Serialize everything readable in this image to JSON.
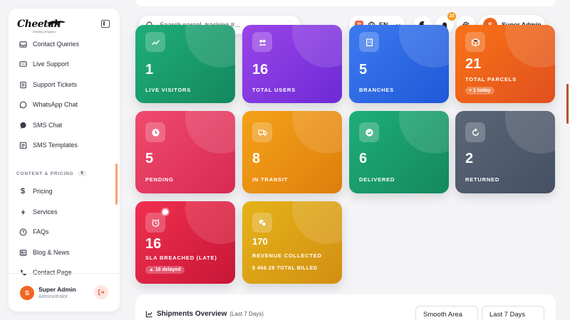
{
  "brand": {
    "name": "Cheetah",
    "tagline": "Delivery at Speed"
  },
  "sidebar": {
    "items_top": [
      {
        "label": "Contact Queries",
        "icon": "inbox-icon"
      },
      {
        "label": "Live Support",
        "icon": "chat-dots-icon"
      },
      {
        "label": "Support Tickets",
        "icon": "ticket-icon"
      },
      {
        "label": "WhatsApp Chat",
        "icon": "whatsapp-icon"
      },
      {
        "label": "SMS Chat",
        "icon": "sms-chat-icon"
      },
      {
        "label": "SMS Templates",
        "icon": "template-icon"
      }
    ],
    "section": {
      "label": "CONTENT & PRICING",
      "count": "9"
    },
    "items_bottom": [
      {
        "label": "Pricing",
        "icon": "dollar-icon"
      },
      {
        "label": "Services",
        "icon": "bolt-icon"
      },
      {
        "label": "FAQs",
        "icon": "question-icon"
      },
      {
        "label": "Blog & News",
        "icon": "newspaper-icon"
      },
      {
        "label": "Contact Page",
        "icon": "phone-icon"
      }
    ],
    "user": {
      "initial": "S",
      "name": "Super Admin",
      "role": "Administrator"
    }
  },
  "header": {
    "search_placeholder": "Search parcel, tracking #...",
    "language": "EN",
    "notifications": "23",
    "user_initial": "S",
    "user_name": "Super Admin"
  },
  "stats": [
    {
      "value": "1",
      "label": "LIVE VISITORS",
      "icon": "chart-icon",
      "color": "#1fae7b"
    },
    {
      "value": "16",
      "label": "TOTAL USERS",
      "icon": "users-icon",
      "color": "#8a3ce6"
    },
    {
      "value": "5",
      "label": "BRANCHES",
      "icon": "building-icon",
      "color": "#3070ea"
    },
    {
      "value": "21",
      "label": "TOTAL PARCELS",
      "icon": "box-icon",
      "color": "#f0651d",
      "chip": "+ 1 today"
    },
    {
      "value": "5",
      "label": "PENDING",
      "icon": "clock-icon",
      "color": "#e8405f"
    },
    {
      "value": "8",
      "label": "IN TRANSIT",
      "icon": "truck-icon",
      "color": "#ee9317"
    },
    {
      "value": "6",
      "label": "DELIVERED",
      "icon": "check-circle-icon",
      "color": "#1fae7b"
    },
    {
      "value": "2",
      "label": "RETURNED",
      "icon": "rotate-icon",
      "color": "#525d6f"
    },
    {
      "value": "16",
      "label": "SLA BREACHED (LATE)",
      "icon": "alarm-icon",
      "color": "#e02444",
      "chip": "16 delayed"
    },
    {
      "value": "170",
      "label": "REVENUE COLLECTED",
      "icon": "coins-icon",
      "color": "#dea216",
      "sub": "$ 466.28 TOTAL BILLED"
    }
  ],
  "shipments": {
    "title": "Shipments Overview",
    "period_note": "(Last 7 Days)",
    "chart_type": "Smooth Area",
    "range": "Last 7 Days"
  }
}
